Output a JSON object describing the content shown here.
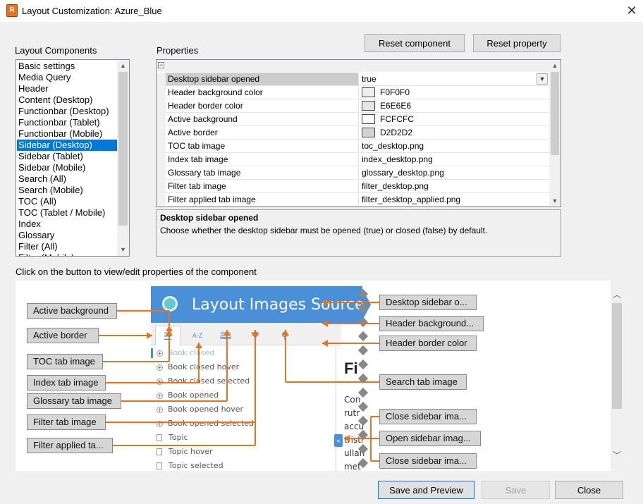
{
  "window": {
    "title": "Layout Customization: Azure_Blue",
    "close_glyph": "✕",
    "app_icon": "app-icon"
  },
  "top_buttons": {
    "reset_component": "Reset component",
    "reset_property": "Reset property"
  },
  "layout_components": {
    "label": "Layout Components",
    "items": [
      "Basic settings",
      "Media Query",
      "Header",
      "Content (Desktop)",
      "Functionbar (Desktop)",
      "Functionbar (Tablet)",
      "Functionbar (Mobile)",
      "Sidebar (Desktop)",
      "Sidebar (Tablet)",
      "Sidebar (Mobile)",
      "Search (All)",
      "Search (Mobile)",
      "TOC (All)",
      "TOC (Tablet / Mobile)",
      "Index",
      "Glossary",
      "Filter (All)",
      "Filter (Mobile)"
    ],
    "selected": "Sidebar (Desktop)"
  },
  "properties": {
    "label": "Properties",
    "collapse_glyph": "−",
    "rows": [
      {
        "name": "Desktop sidebar opened",
        "value": "true",
        "dropdown": true
      },
      {
        "name": "Header background color",
        "value": "F0F0F0",
        "color": "#F0F0F0"
      },
      {
        "name": "Header border color",
        "value": "E6E6E6",
        "color": "#E6E6E6"
      },
      {
        "name": "Active background",
        "value": "FCFCFC",
        "color": "#FCFCFC"
      },
      {
        "name": "Active border",
        "value": "D2D2D2",
        "color": "#D2D2D2"
      },
      {
        "name": "TOC tab image",
        "value": "toc_desktop.png"
      },
      {
        "name": "Index tab image",
        "value": "index_desktop.png"
      },
      {
        "name": "Glossary tab image",
        "value": "glossary_desktop.png"
      },
      {
        "name": "Filter tab image",
        "value": "filter_desktop.png"
      },
      {
        "name": "Filter applied tab image",
        "value": "filter_desktop_applied.png"
      }
    ],
    "selected": "Desktop sidebar opened"
  },
  "description": {
    "title": "Desktop sidebar opened",
    "text": "Choose whether the desktop sidebar must be opened (true) or closed (false) by default."
  },
  "preview": {
    "instruction": "Click on the button to view/edit properties of the component",
    "mock_title": "Layout Images Source",
    "mock_items": [
      "Book closed",
      "Book closed hover",
      "Book closed selected",
      "Book opened",
      "Book opened hover",
      "Book opened selected",
      "Topic",
      "Topic hover",
      "Topic selected"
    ],
    "mock_content_heading": "Fi",
    "mock_content_lines": [
      "Con",
      "rutr",
      "accu",
      "tristi",
      "ullan",
      "met"
    ],
    "collapse_glyph": "«",
    "annotations_left": [
      "Active background",
      "Active border",
      "TOC tab image",
      "Index tab image",
      "Glossary tab image",
      "Filter tab image",
      "Filter applied ta..."
    ],
    "annotations_right": [
      "Desktop sidebar o...",
      "Header background...",
      "Header border color",
      "Search tab image",
      "Close sidebar ima...",
      "Open sidebar imag...",
      "Close sidebar ima..."
    ],
    "accent_color": "#E8731A",
    "header_color": "#4A90D9"
  },
  "bottom_buttons": {
    "save_preview": "Save and Preview",
    "save": "Save",
    "close": "Close"
  },
  "icons": {
    "toc": "list-icon",
    "index": "az-icon",
    "glossary": "book-icon",
    "filter": "funnel-icon",
    "search": "magnifier-icon"
  }
}
